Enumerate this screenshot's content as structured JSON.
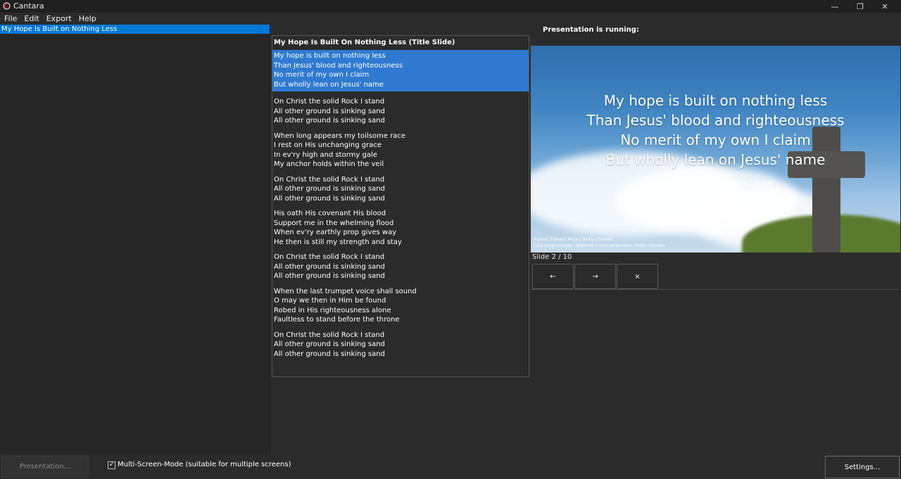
{
  "window": {
    "title": "Cantara",
    "icon": "cantara-app-icon",
    "controls": {
      "minimize": "—",
      "restore": "❐",
      "close": "✕"
    }
  },
  "menu": [
    {
      "label": "File"
    },
    {
      "label": "Edit"
    },
    {
      "label": "Export"
    },
    {
      "label": "Help"
    }
  ],
  "song_list": {
    "items": [
      {
        "label": "My Hope Is Built on Nothing Less",
        "selected": true
      }
    ]
  },
  "slides": {
    "title": "My Hope Is Built On Nothing Less (Title Slide)",
    "stanzas": [
      {
        "selected": true,
        "lines": [
          "My hope is built on nothing less",
          "Than Jesus' blood and righteousness",
          "No merit of my own I claim",
          "But wholly lean on Jesus' name"
        ]
      },
      {
        "selected": false,
        "lines": [
          "On Christ the solid Rock I stand",
          "All other ground is sinking sand",
          "All other ground is sinking sand"
        ]
      },
      {
        "selected": false,
        "lines": [
          "When long appears my toilsome race",
          "I rest on His unchanging grace",
          "In ev'ry high and stormy gale",
          "My anchor holds within the veil"
        ]
      },
      {
        "selected": false,
        "lines": [
          "On Christ the solid Rock I stand",
          "All other ground is sinking sand",
          "All other ground is sinking sand"
        ]
      },
      {
        "selected": false,
        "lines": [
          "His oath His covenant His blood",
          "Support me in the whelming flood",
          "When ev'ry earthly prop gives way",
          "He then is still my strength and stay"
        ]
      },
      {
        "selected": false,
        "lines": [
          "On Christ the solid Rock I stand",
          "All other ground is sinking sand",
          "All other ground is sinking sand"
        ]
      },
      {
        "selected": false,
        "lines": [
          "When the last trumpet voice shall sound",
          "O may we then in Him be found",
          "Robed in His righteousness alone",
          "Faultless to stand before the throne"
        ]
      },
      {
        "selected": false,
        "lines": [
          "On Christ the solid Rock I stand",
          "All other ground is sinking sand",
          "All other ground is sinking sand"
        ]
      }
    ]
  },
  "presentation": {
    "status": "Presentation is running:",
    "preview": {
      "main_lines": [
        "My hope is built on nothing less",
        "Than Jesus' blood and righteousness",
        "No merit of my own I claim",
        "But wholly lean on Jesus' name"
      ],
      "next_lines": [
        "On Christ the solid Rock I stand",
        "All other ground is sinking sand",
        "All other ground is sinking sand"
      ],
      "footer": [
        "Author: Edward Mote | Nicky Chiswell",
        "CCLI song number: 2585446 | License Number: Public Domain"
      ]
    },
    "slide_counter": "Slide 2 / 10",
    "controls": {
      "prev": "←",
      "next": "→",
      "close": "×"
    }
  },
  "bottom": {
    "presentation_button": "Presentation...",
    "multi_screen": {
      "label": "Multi-Screen-Mode (suitable for multiple screens)",
      "checked": true,
      "mark": "✓"
    },
    "settings_button": "Settings..."
  },
  "colors": {
    "accent": "#0078d7",
    "selection": "#2f7ad0",
    "background": "#2b2b2b",
    "titlebar": "#202020"
  }
}
